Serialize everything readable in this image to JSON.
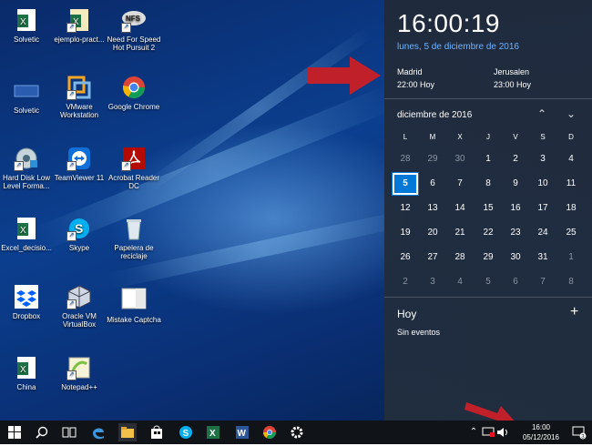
{
  "desktop": {
    "icons": [
      {
        "label": "Solvetic",
        "icon": "excel-file-icon"
      },
      {
        "label": "ejemplo-pract...",
        "icon": "excel-file-icon"
      },
      {
        "label": "Need For Speed\nHot Pursuit 2",
        "icon": "nfs-game-icon"
      },
      {
        "label": "Solvetic",
        "icon": "folder-shortcut-icon"
      },
      {
        "label": "VMware\nWorkstation",
        "icon": "vmware-icon"
      },
      {
        "label": "Google Chrome",
        "icon": "chrome-icon"
      },
      {
        "label": "Hard Disk Low\nLevel Forma...",
        "icon": "hdd-tool-icon"
      },
      {
        "label": "TeamViewer 11",
        "icon": "teamviewer-icon"
      },
      {
        "label": "Acrobat Reader\nDC",
        "icon": "acrobat-icon"
      },
      {
        "label": "Excel_decisio...",
        "icon": "excel-file-icon"
      },
      {
        "label": "Skype",
        "icon": "skype-icon"
      },
      {
        "label": "Papelera de\nreciclaje",
        "icon": "recycle-bin-icon"
      },
      {
        "label": "Dropbox",
        "icon": "dropbox-icon"
      },
      {
        "label": "Oracle VM\nVirtualBox",
        "icon": "virtualbox-icon"
      },
      {
        "label": "Mistake Captcha",
        "icon": "captcha-icon"
      },
      {
        "label": "China",
        "icon": "excel-file-icon"
      },
      {
        "label": "Notepad++",
        "icon": "notepadpp-icon"
      }
    ]
  },
  "panel": {
    "time": "16:00:19",
    "date": "lunes, 5 de diciembre de 2016",
    "zones": [
      {
        "city": "Madrid",
        "time": "22:00 Hoy"
      },
      {
        "city": "Jerusalen",
        "time": "23:00 Hoy"
      }
    ],
    "month_label": "diciembre de 2016",
    "weekdays": [
      "L",
      "M",
      "X",
      "J",
      "V",
      "S",
      "D"
    ],
    "days": [
      [
        "28",
        "29",
        "30",
        "1",
        "2",
        "3",
        "4"
      ],
      [
        "5",
        "6",
        "7",
        "8",
        "9",
        "10",
        "11"
      ],
      [
        "12",
        "13",
        "14",
        "15",
        "16",
        "17",
        "18"
      ],
      [
        "19",
        "20",
        "21",
        "22",
        "23",
        "24",
        "25"
      ],
      [
        "26",
        "27",
        "28",
        "29",
        "30",
        "31",
        "1"
      ],
      [
        "2",
        "3",
        "4",
        "5",
        "6",
        "7",
        "8"
      ]
    ],
    "today": "5",
    "agenda_title": "Hoy",
    "agenda_empty": "Sin eventos"
  },
  "taskbar": {
    "clock_time": "16:00",
    "clock_date": "05/12/2016",
    "notification_count": "3",
    "pinned": [
      "start-icon",
      "search-icon",
      "task-view-icon",
      "edge-icon",
      "file-explorer-icon",
      "store-icon",
      "skype-icon",
      "excel-icon",
      "word-icon",
      "chrome-icon",
      "settings-icon"
    ]
  },
  "colors": {
    "accent": "#0078d7",
    "date_link": "#6fb3ff",
    "arrow": "#c0202a"
  }
}
